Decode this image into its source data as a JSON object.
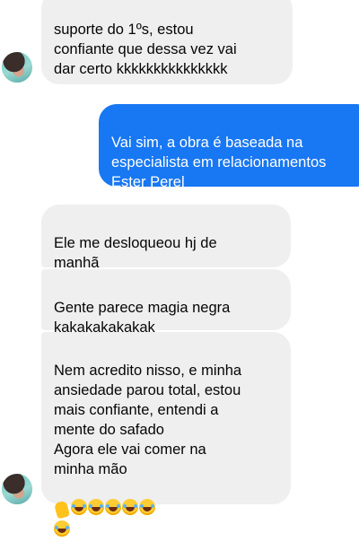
{
  "messages": [
    {
      "id": "m1",
      "direction": "incoming",
      "lines": "suporte do 1ºs, estou\nconfiante que dessa vez vai\ndar certo kkkkkkkkkkkkkkk"
    },
    {
      "id": "m2",
      "direction": "outgoing",
      "lines": "Vai sim, a obra é baseada na\nespecialista em relacionamentos\nEster Perel"
    },
    {
      "id": "m3",
      "direction": "incoming",
      "lines": "Ele me desloqueou hj de\nmanhã"
    },
    {
      "id": "m4",
      "direction": "incoming",
      "lines": "Gente parece magia negra\nkakakakakakak"
    },
    {
      "id": "m5",
      "direction": "incoming",
      "lines": "Nem acredito nisso, e minha\nansiedade parou total, estou\nmais confiante, entendi a\nmente do safado\nAgora ele vai comer na\nminha mão",
      "trailing_emojis": [
        "raised-hand-emoji",
        "tears-of-joy-emoji",
        "tears-of-joy-emoji",
        "tears-of-joy-emoji",
        "tears-of-joy-emoji",
        "tears-of-joy-emoji",
        "tears-of-joy-emoji"
      ]
    }
  ],
  "colors": {
    "incoming_bubble": "#efefef",
    "outgoing_bubble": "#1877f2",
    "incoming_text": "#050505",
    "outgoing_text": "#ffffff"
  },
  "icons": {
    "sender_avatar": "avatar-photo"
  }
}
